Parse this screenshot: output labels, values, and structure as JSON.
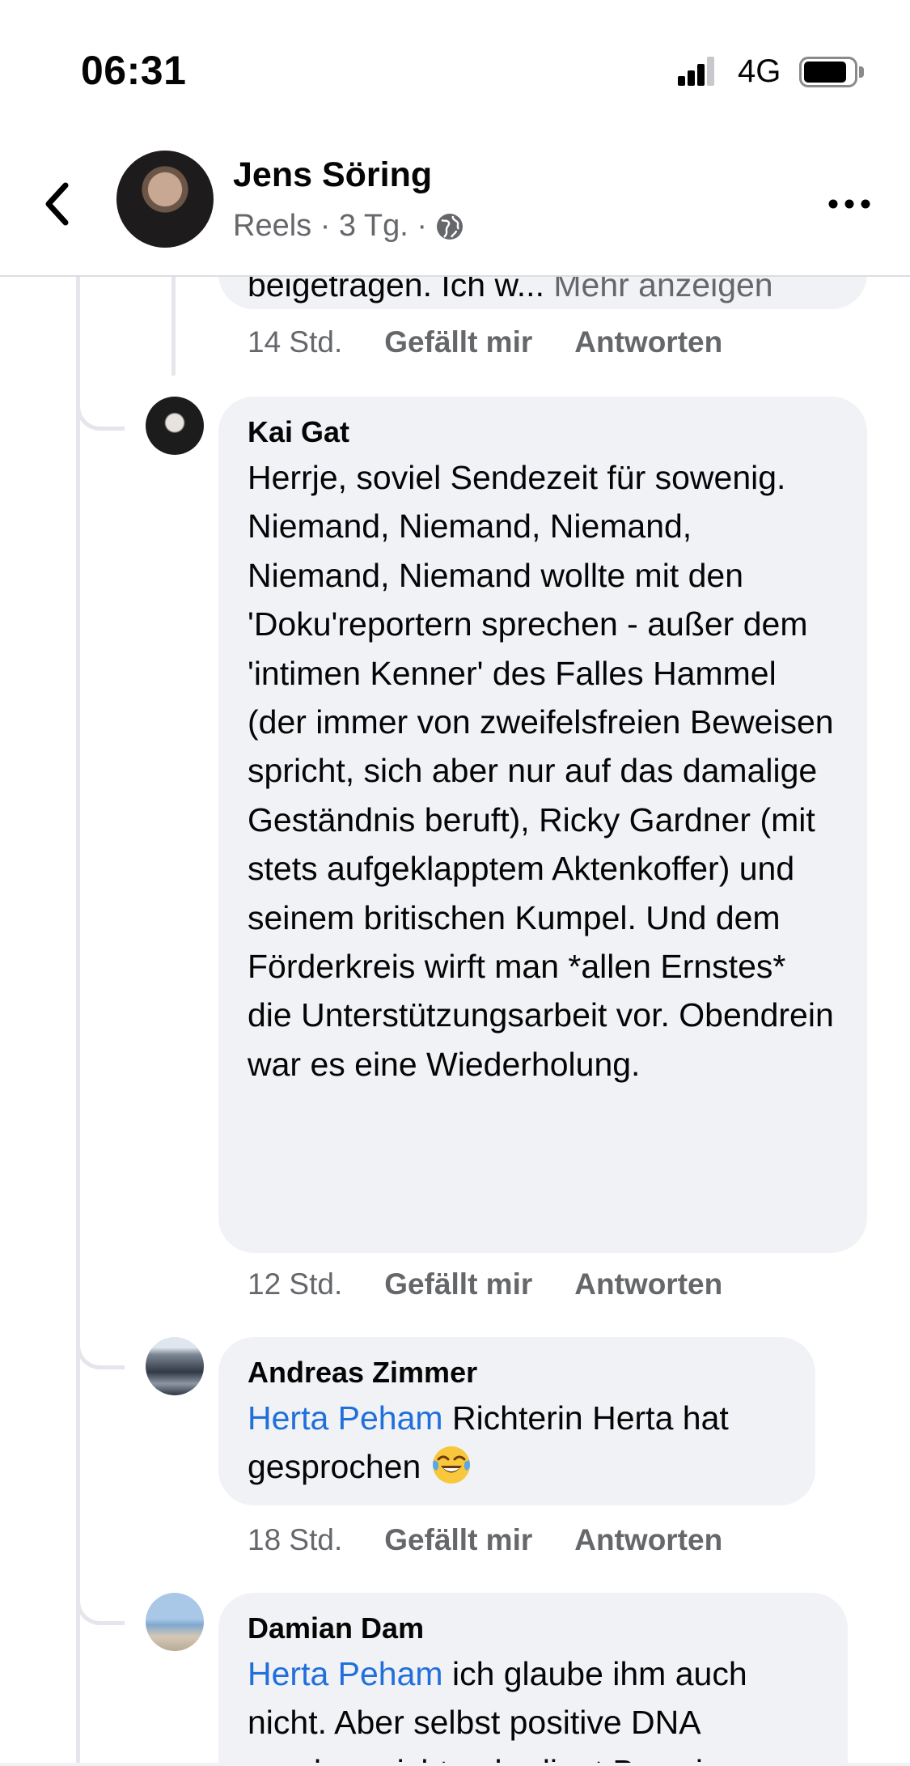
{
  "status_bar": {
    "time": "06:31",
    "network": "4G"
  },
  "header": {
    "name": "Jens Söring",
    "meta": "Reels · 3 Tg. ·"
  },
  "comments": [
    {
      "id": "truncated",
      "text": "beigetragen. Ich w...",
      "more_label": "Mehr anzeigen",
      "time": "14 Std.",
      "like_label": "Gefällt mir",
      "reply_label": "Antworten"
    },
    {
      "id": "kai",
      "author": "Kai Gat",
      "text": "Herrje, soviel Sendezeit für sowenig. Niemand, Niemand, Niemand, Niemand, Niemand wollte mit den 'Doku'reportern sprechen - außer dem 'intimen Kenner' des Falles Hammel (der immer von zweifelsfreien Beweisen spricht, sich aber nur auf das damalige Geständnis beruft), Ricky Gardner (mit stets aufgeklapptem Aktenkoffer) und seinem britischen Kumpel. Und dem Förderkreis wirft man *allen Ernstes* die Unterstützungsarbeit vor. Obendrein war es eine Wiederholung.",
      "time": "12 Std.",
      "like_label": "Gefällt mir",
      "reply_label": "Antworten"
    },
    {
      "id": "andreas",
      "author": "Andreas Zimmer",
      "mention": "Herta Peham",
      "text_line1": " Richterin Herta hat",
      "text_line2": "gesprochen",
      "time": "18 Std.",
      "like_label": "Gefällt mir",
      "reply_label": "Antworten"
    },
    {
      "id": "damian",
      "author": "Damian Dam",
      "mention": "Herta Peham",
      "text_line1": " ich glaube ihm auch",
      "text_line2": "nicht. Aber selbst positive DNA",
      "text_line3": "ergeben nicht unbedingt Beweis"
    }
  ]
}
